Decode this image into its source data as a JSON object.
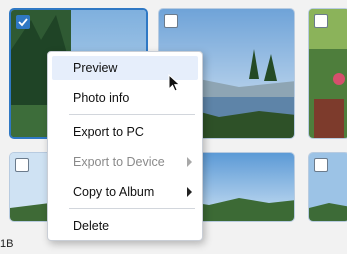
{
  "thumbnails": [
    {
      "selected": true
    },
    {
      "selected": false
    },
    {
      "selected": false
    },
    {
      "selected": false
    },
    {
      "selected": false
    },
    {
      "selected": false
    }
  ],
  "context_menu": {
    "items": [
      {
        "label": "Preview",
        "enabled": true,
        "submenu": false
      },
      {
        "label": "Photo info",
        "enabled": true,
        "submenu": false
      },
      {
        "label": "Export to PC",
        "enabled": true,
        "submenu": false
      },
      {
        "label": "Export to Device",
        "enabled": false,
        "submenu": true
      },
      {
        "label": "Copy to Album",
        "enabled": true,
        "submenu": true
      },
      {
        "label": "Delete",
        "enabled": true,
        "submenu": false
      }
    ]
  },
  "status_text": "1B",
  "colors": {
    "accent": "#2f78c4",
    "hover": "#e6eefb",
    "disabled_text": "#8a8a8a"
  },
  "icons": {
    "checkbox_checked": "checkmark-icon",
    "submenu": "chevron-right-icon",
    "cursor": "mouse-pointer-icon"
  }
}
